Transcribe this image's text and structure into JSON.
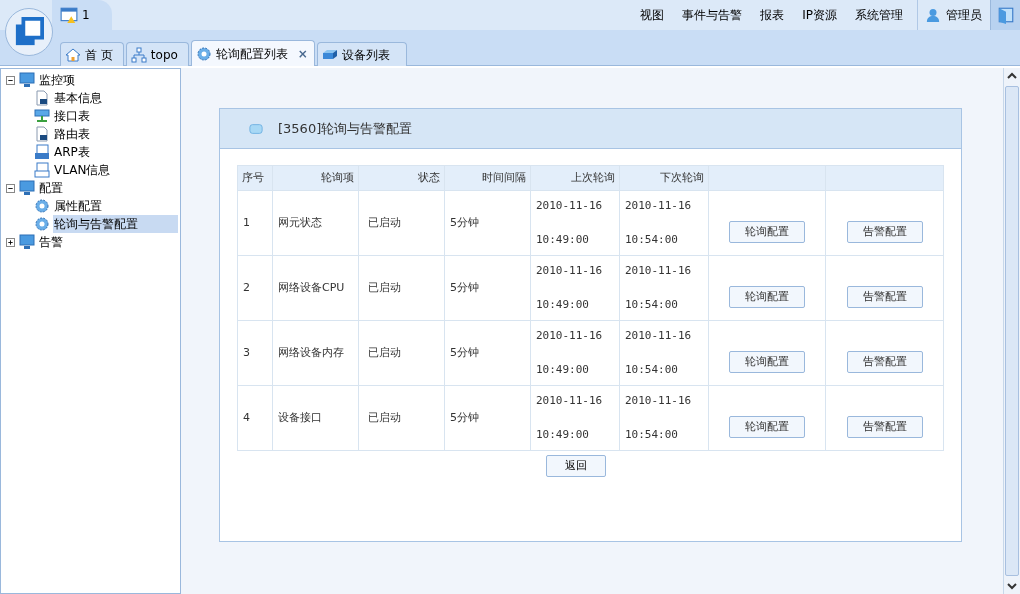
{
  "top_tab": {
    "label": "1"
  },
  "menu": [
    "视图",
    "事件与告警",
    "报表",
    "IP资源",
    "系统管理"
  ],
  "user": "管理员",
  "tabs": [
    {
      "label": "首 页",
      "kind": "home",
      "selected": false
    },
    {
      "label": "topo",
      "kind": "topo",
      "selected": false
    },
    {
      "label": "轮询配置列表",
      "kind": "gear",
      "selected": true,
      "close": "×"
    },
    {
      "label": "设备列表",
      "kind": "device",
      "selected": false
    }
  ],
  "tree": [
    {
      "label": "监控项",
      "expanded": true,
      "children": [
        {
          "label": "基本信息",
          "kind": "doc",
          "selected": false
        },
        {
          "label": "接口表",
          "kind": "net",
          "selected": false
        },
        {
          "label": "路由表",
          "kind": "doc",
          "selected": false
        },
        {
          "label": "ARP表",
          "kind": "arp",
          "selected": false
        },
        {
          "label": "VLAN信息",
          "kind": "vlan",
          "selected": false
        }
      ]
    },
    {
      "label": "配置",
      "expanded": true,
      "children": [
        {
          "label": "属性配置",
          "kind": "gear",
          "selected": false
        },
        {
          "label": "轮询与告警配置",
          "kind": "gear",
          "selected": true
        }
      ]
    },
    {
      "label": "告警",
      "expanded": false
    }
  ],
  "panel": {
    "title": "[3560]轮询与告警配置",
    "columns": [
      "序号",
      "轮询项",
      "状态",
      "时间间隔",
      "上次轮询",
      "下次轮询"
    ],
    "rows": [
      {
        "index": "1",
        "item": "网元状态",
        "status": "已启动",
        "interval": "5分钟",
        "last": [
          "2010-11-16",
          "10:49:00"
        ],
        "next": [
          "2010-11-16",
          "10:54:00"
        ],
        "actions": [
          "轮询配置",
          "告警配置"
        ]
      },
      {
        "index": "2",
        "item": "网络设备CPU",
        "status": "已启动",
        "interval": "5分钟",
        "last": [
          "2010-11-16",
          "10:49:00"
        ],
        "next": [
          "2010-11-16",
          "10:54:00"
        ],
        "actions": [
          "轮询配置",
          "告警配置"
        ]
      },
      {
        "index": "3",
        "item": "网络设备内存",
        "status": "已启动",
        "interval": "5分钟",
        "last": [
          "2010-11-16",
          "10:49:00"
        ],
        "next": [
          "2010-11-16",
          "10:54:00"
        ],
        "actions": [
          "轮询配置",
          "告警配置"
        ]
      },
      {
        "index": "4",
        "item": "设备接口",
        "status": "已启动",
        "interval": "5分钟",
        "last": [
          "2010-11-16",
          "10:49:00"
        ],
        "next": [
          "2010-11-16",
          "10:54:00"
        ],
        "actions": [
          "轮询配置",
          "告警配置"
        ]
      }
    ],
    "back_button": "返回"
  }
}
